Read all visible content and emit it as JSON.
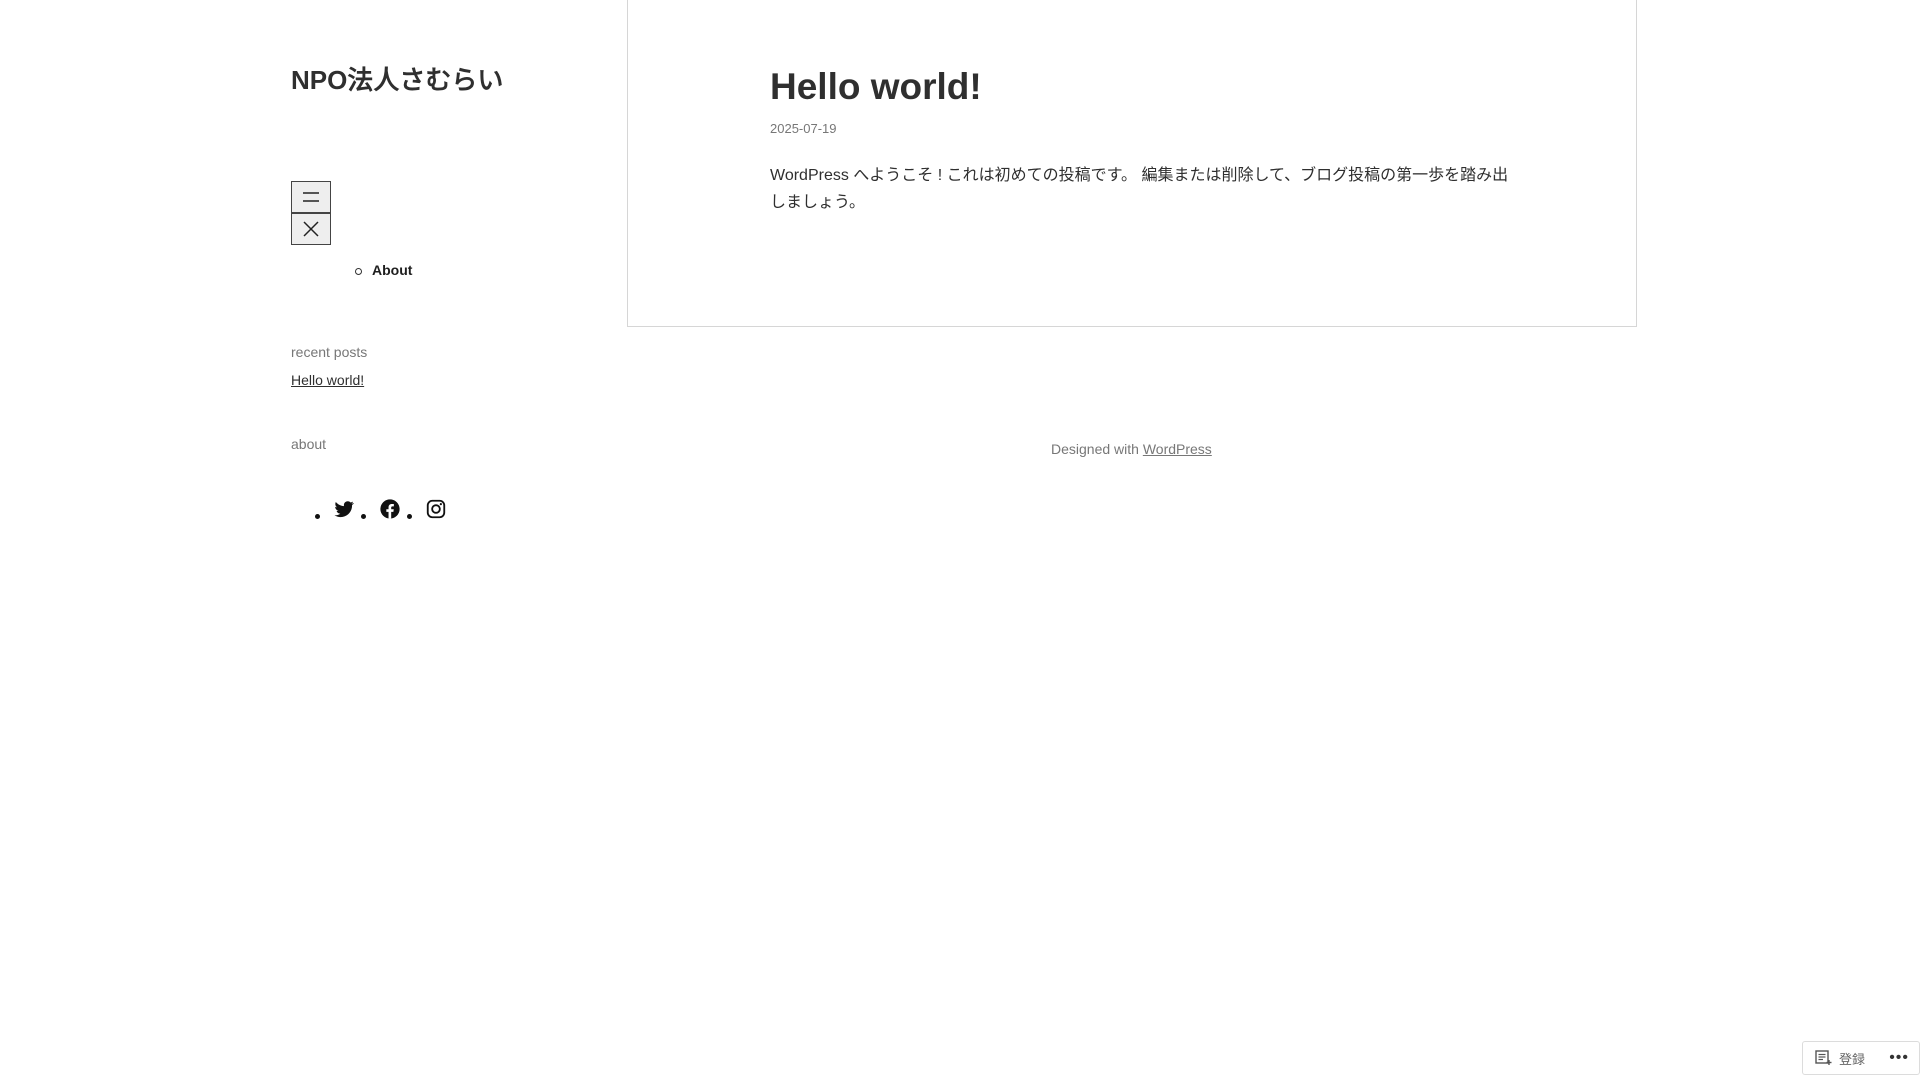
{
  "site": {
    "title": "NPO法人さむらい"
  },
  "nav": {
    "open_icon": "menu-icon",
    "close_icon": "close-icon",
    "items": [
      {
        "label": "About"
      }
    ]
  },
  "widgets": {
    "recent_title": "recent posts",
    "recent_posts": [
      "Hello world!"
    ],
    "about_title": "about",
    "social": [
      "twitter-icon",
      "facebook-icon",
      "instagram-icon"
    ]
  },
  "post": {
    "title": "Hello world!",
    "date": "2025-07-19",
    "body": "WordPress へようこそ ! これは初めての投稿です。 編集または削除して、ブログ投稿の第一歩を踏み出しましょう。"
  },
  "footer": {
    "prefix": "Designed with ",
    "link": "WordPress"
  },
  "admin": {
    "signup_label": "登録",
    "more_label": "•••"
  }
}
